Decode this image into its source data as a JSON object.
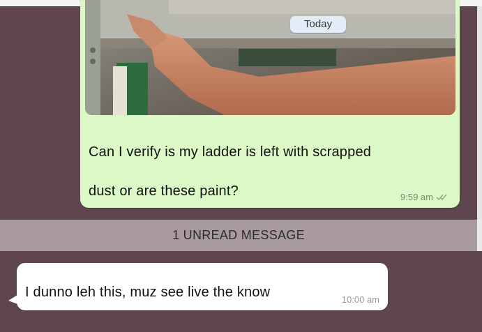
{
  "chat": {
    "date_label": "Today",
    "outgoing": {
      "text": "Can I verify is my ladder is left with scrapped\ndust or are these paint?",
      "time": "9:59 am",
      "status_icon": "double-check-icon",
      "image": "photo-attachment"
    },
    "unread_divider": "1 UNREAD MESSAGE",
    "incoming": {
      "text": "I dunno leh this, muz see live the know",
      "time": "10:00 am"
    }
  },
  "colors": {
    "chat_background": "#5e4550",
    "outgoing_bubble": "#dcf8c6",
    "incoming_bubble": "#ffffff",
    "unread_bar": "#a89a9f"
  }
}
